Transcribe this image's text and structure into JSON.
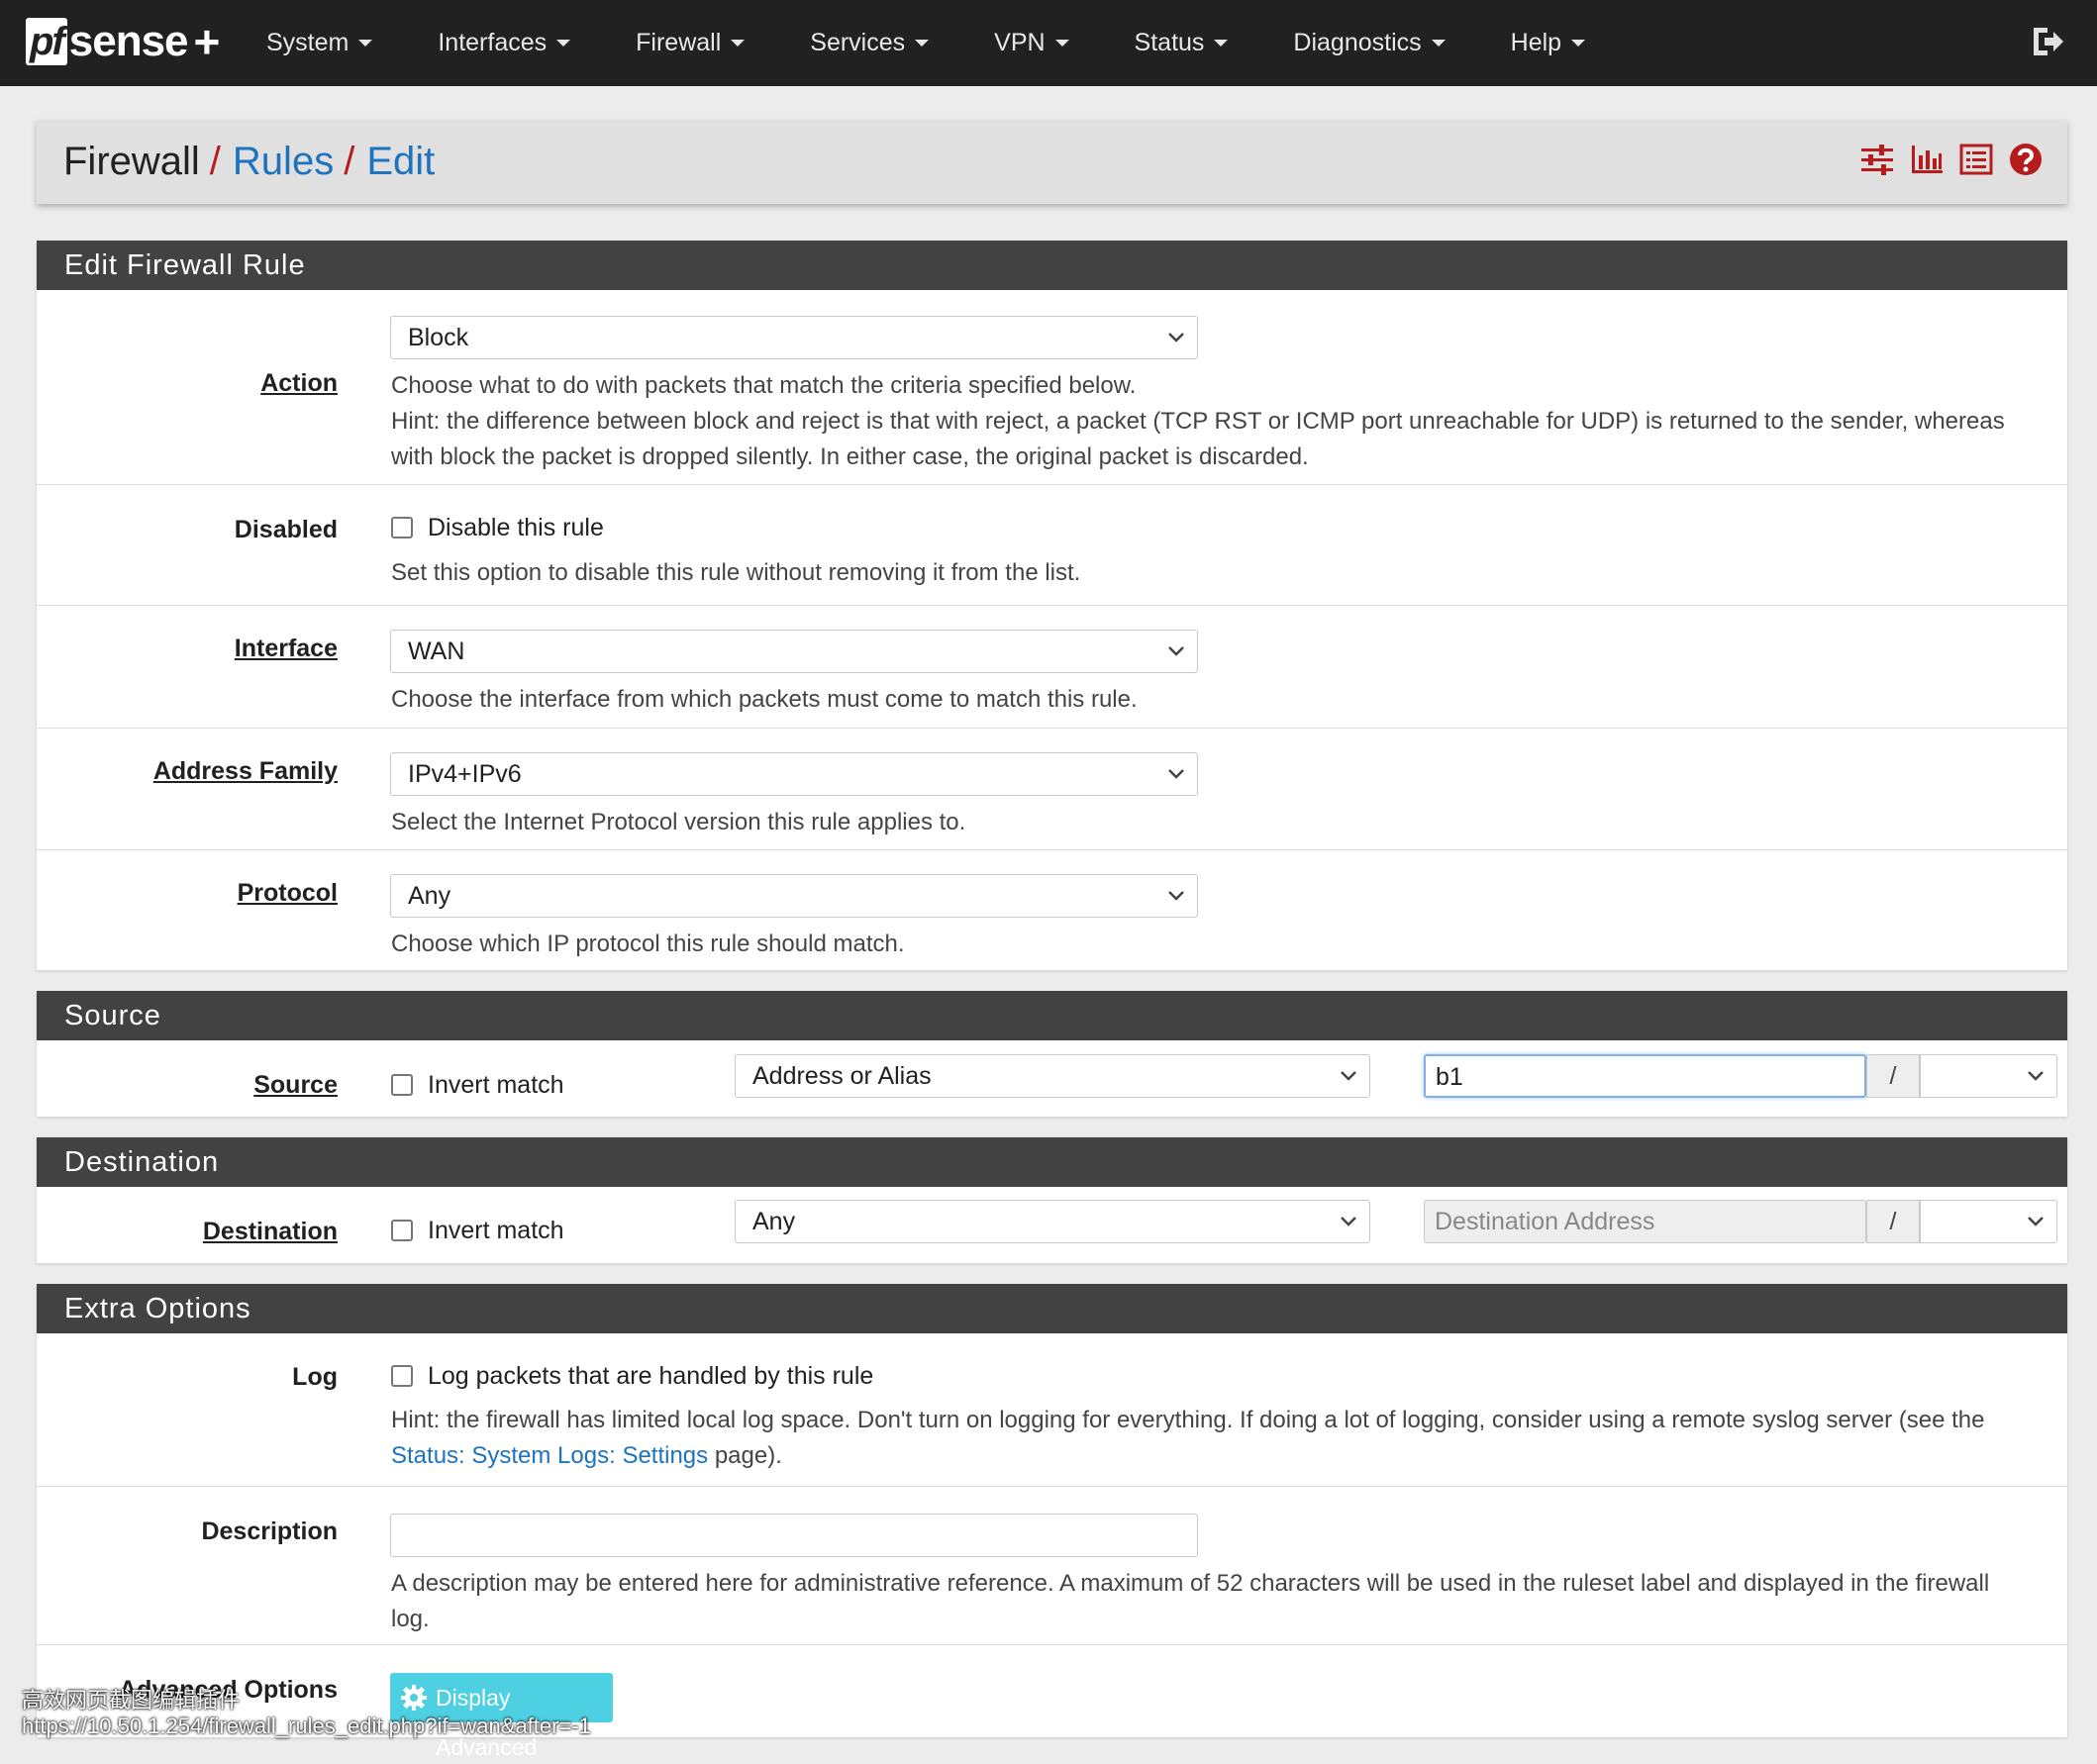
{
  "navbar": {
    "logo_pf": "pf",
    "logo_sense": "sense",
    "logo_plus": "+",
    "menu": [
      "System",
      "Interfaces",
      "Firewall",
      "Services",
      "VPN",
      "Status",
      "Diagnostics",
      "Help"
    ]
  },
  "breadcrumb": {
    "root": "Firewall",
    "sep": "/",
    "rules": "Rules",
    "edit": "Edit"
  },
  "edit_rule": {
    "title": "Edit Firewall Rule",
    "action": {
      "label": "Action",
      "value": "Block",
      "help1": "Choose what to do with packets that match the criteria specified below.",
      "help2": "Hint: the difference between block and reject is that with reject, a packet (TCP RST or ICMP port unreachable for UDP) is returned to the sender, whereas",
      "help3": "with block the packet is dropped silently. In either case, the original packet is discarded."
    },
    "disabled": {
      "label": "Disabled",
      "checkbox": "Disable this rule",
      "help": "Set this option to disable this rule without removing it from the list."
    },
    "interface": {
      "label": "Interface",
      "value": "WAN",
      "help": "Choose the interface from which packets must come to match this rule."
    },
    "address_family": {
      "label": "Address Family",
      "value": "IPv4+IPv6",
      "help": "Select the Internet Protocol version this rule applies to."
    },
    "protocol": {
      "label": "Protocol",
      "value": "Any",
      "help": "Choose which IP protocol this rule should match."
    }
  },
  "source": {
    "title": "Source",
    "label": "Source",
    "invert": "Invert match",
    "type": "Address or Alias",
    "address": "b1",
    "slash": "/"
  },
  "destination": {
    "title": "Destination",
    "label": "Destination",
    "invert": "Invert match",
    "type": "Any",
    "address_placeholder": "Destination Address",
    "slash": "/"
  },
  "extra": {
    "title": "Extra Options",
    "log": {
      "label": "Log",
      "checkbox": "Log packets that are handled by this rule",
      "help1": "Hint: the firewall has limited local log space. Don't turn on logging for everything. If doing a lot of logging, consider using a remote syslog server (see the",
      "help_link": "Status: System Logs: Settings",
      "help_end": " page)."
    },
    "description": {
      "label": "Description",
      "value": "",
      "help1": "A description may be entered here for administrative reference. A maximum of 52 characters will be used in the ruleset label and displayed in the firewall",
      "help2": "log."
    },
    "advanced": {
      "label": "Advanced Options",
      "button": "Display Advanced"
    }
  },
  "overlay": {
    "line1": "高效网页截图编辑插件",
    "url": "https://10.50.1.254/firewall_rules_edit.php?if=wan&after=-1"
  },
  "colors": {
    "navbar": "#212121",
    "panel_header": "#424242",
    "link": "#1e73be",
    "accent_red": "#b71c1c",
    "button": "#4dd0e1"
  }
}
